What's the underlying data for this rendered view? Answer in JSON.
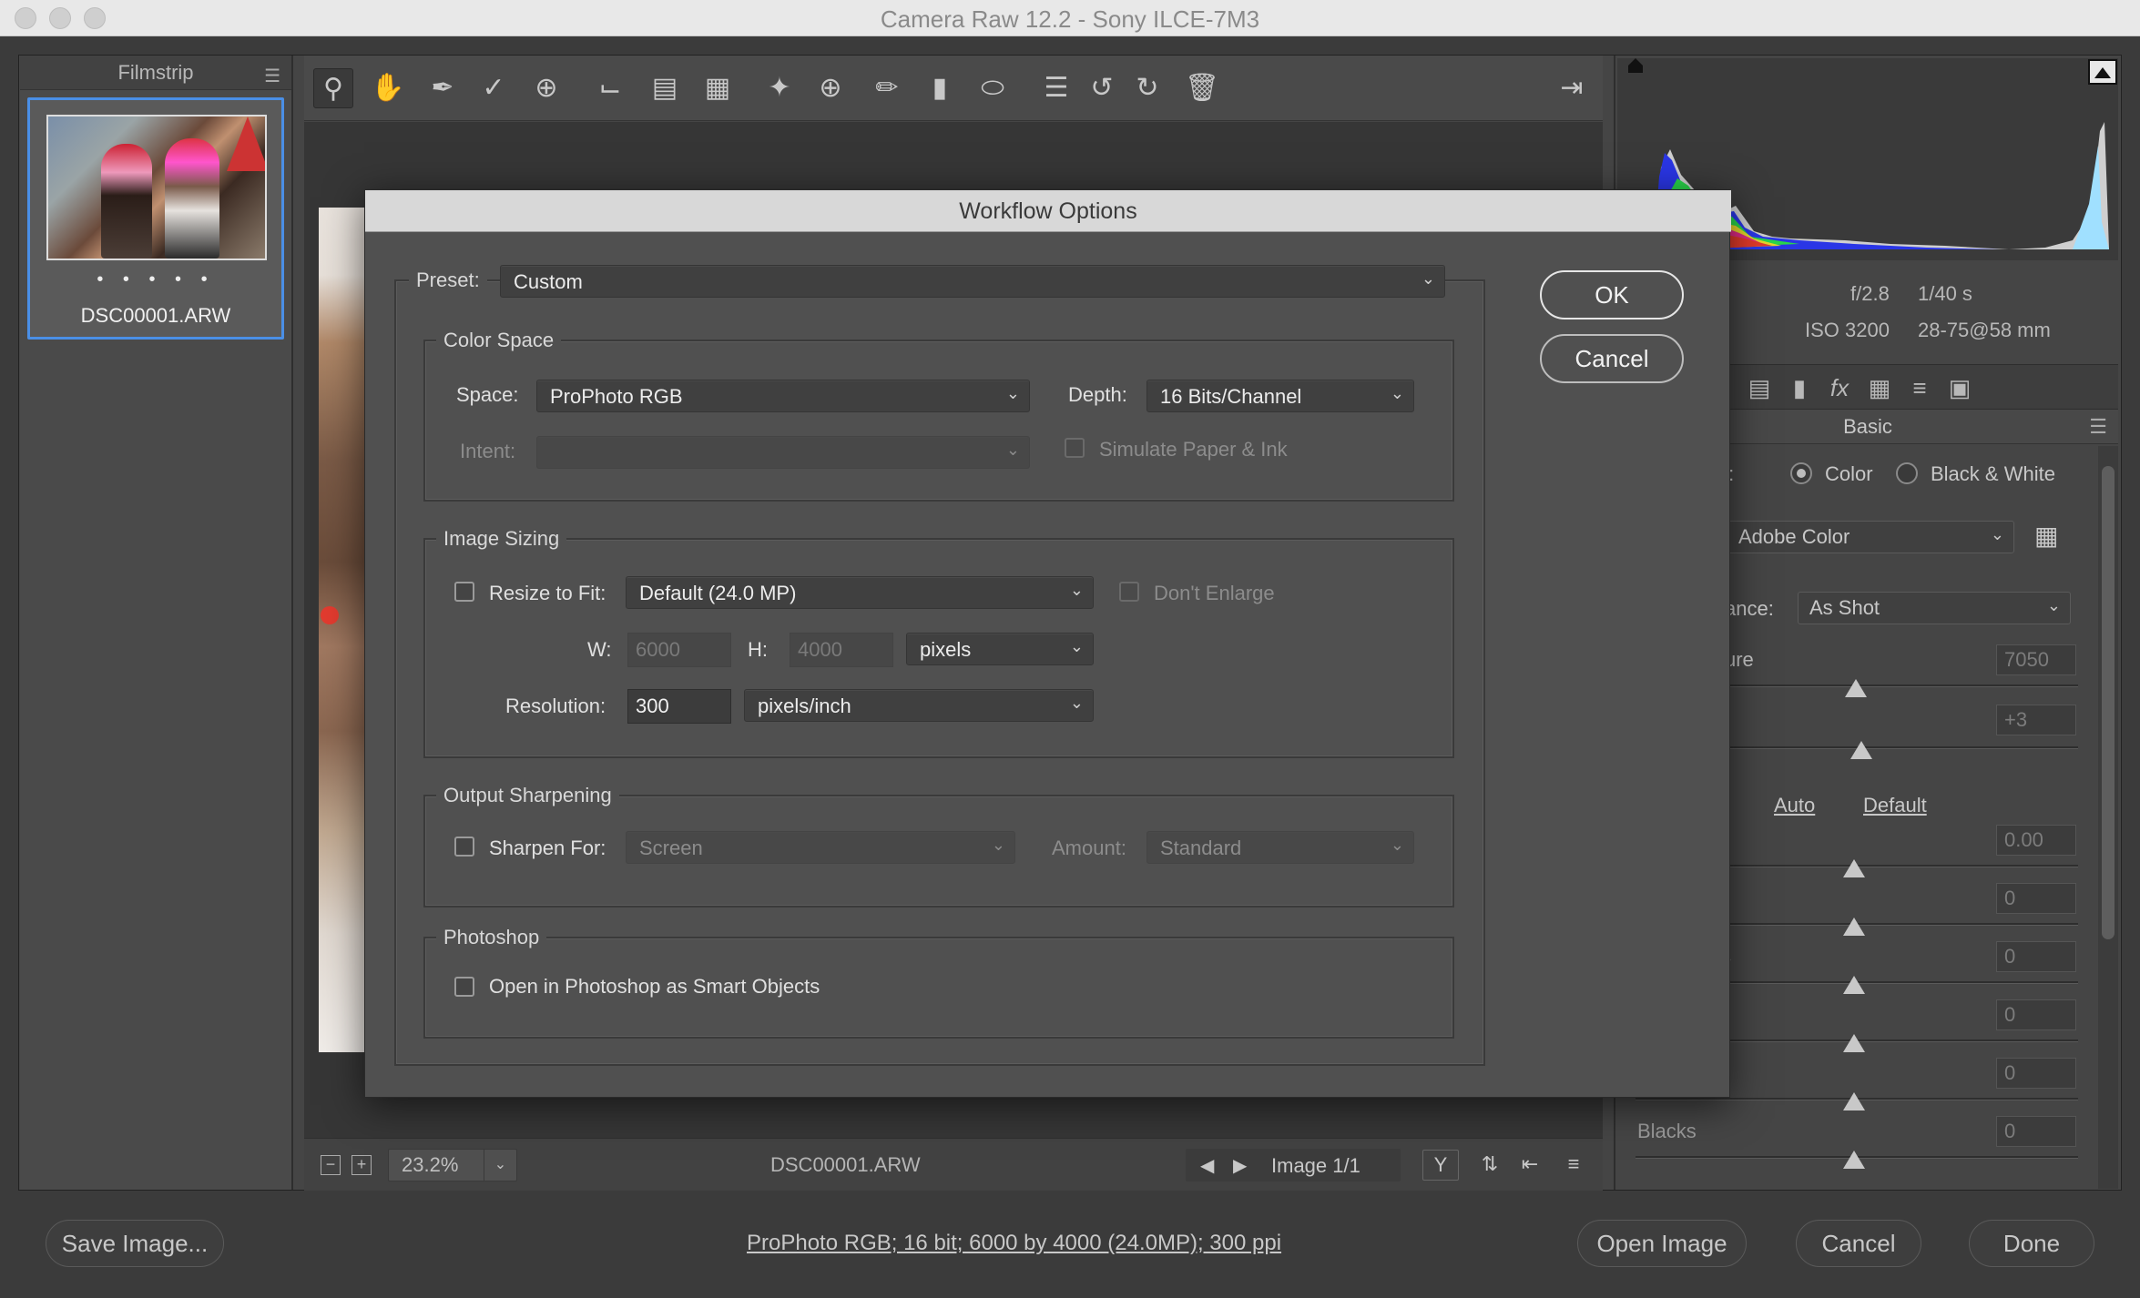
{
  "window": {
    "title": "Camera Raw 12.2  -  Sony ILCE-7M3"
  },
  "filmstrip": {
    "header": "Filmstrip",
    "items": [
      {
        "filename": "DSC00001.ARW",
        "rating_dots": "• • • • •"
      }
    ]
  },
  "toolbar": {
    "tools": [
      "zoom-tool",
      "hand-tool",
      "white-balance-tool",
      "color-sampler-tool",
      "targeted-adjustment-tool",
      "crop-tool",
      "straighten-tool",
      "transform-tool",
      "spot-removal-tool",
      "red-eye-tool",
      "adjustment-brush",
      "graduated-filter",
      "radial-filter",
      "preferences",
      "rotate-left",
      "rotate-right",
      "trash"
    ]
  },
  "canvas_bar": {
    "zoom": "23.2%",
    "filename": "DSC00001.ARW",
    "image_index": "Image 1/1"
  },
  "right_panel": {
    "aperture": "f/2.8",
    "shutter": "1/40 s",
    "iso": "ISO 3200",
    "lens": "28-75@58 mm",
    "section": "Basic",
    "treatment_partial": "t:",
    "treatment_color": "Color",
    "treatment_bw": "Black & White",
    "profile": "Adobe Color",
    "wb_label_partial": "ance:",
    "wb_value": "As Shot",
    "temp_label_partial": "ure",
    "temp_value": "7050",
    "tint_value": "+3",
    "auto_link": "Auto",
    "default_link": "Default",
    "exposure_value": "0.00",
    "contrast_value": "0",
    "highlights_label_partial": "s",
    "highlights_value": "0",
    "shadows_value": "0",
    "whites_value": "0",
    "blacks_label": "Blacks",
    "blacks_value": "0"
  },
  "footer": {
    "save_button": "Save Image...",
    "workflow_link": "ProPhoto RGB; 16 bit; 6000 by 4000 (24.0MP); 300 ppi",
    "open_button": "Open Image",
    "cancel_button": "Cancel",
    "done_button": "Done"
  },
  "dialog": {
    "title": "Workflow Options",
    "preset_label": "Preset:",
    "preset_value": "Custom",
    "ok_button": "OK",
    "cancel_button": "Cancel",
    "color_space": {
      "title": "Color Space",
      "space_label": "Space:",
      "space_value": "ProPhoto RGB",
      "depth_label": "Depth:",
      "depth_value": "16 Bits/Channel",
      "intent_label": "Intent:",
      "intent_value": "",
      "simulate_label": "Simulate Paper & Ink"
    },
    "image_sizing": {
      "title": "Image Sizing",
      "resize_label": "Resize to Fit:",
      "resize_value": "Default  (24.0 MP)",
      "dont_enlarge_label": "Don't Enlarge",
      "w_label": "W:",
      "w_value": "6000",
      "h_label": "H:",
      "h_value": "4000",
      "unit_value": "pixels",
      "resolution_label": "Resolution:",
      "resolution_value": "300",
      "resolution_unit": "pixels/inch"
    },
    "output_sharpening": {
      "title": "Output Sharpening",
      "sharpen_label": "Sharpen For:",
      "sharpen_value": "Screen",
      "amount_label": "Amount:",
      "amount_value": "Standard"
    },
    "photoshop": {
      "title": "Photoshop",
      "smart_objects_label": "Open in Photoshop as Smart Objects"
    }
  }
}
